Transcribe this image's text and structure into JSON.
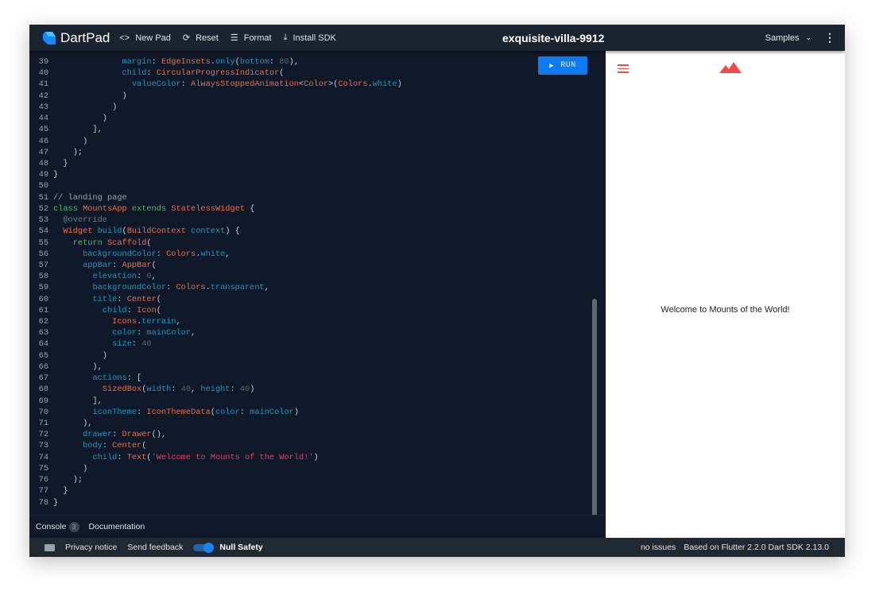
{
  "header": {
    "app_name": "DartPad",
    "new_pad": "New Pad",
    "reset": "Reset",
    "format": "Format",
    "install_sdk": "Install SDK",
    "title": "exquisite-villa-9912",
    "samples": "Samples"
  },
  "editor": {
    "run_label": "RUN",
    "lines": [
      {
        "n": "39",
        "t": [
          [
            "o",
            "              "
          ],
          [
            "p",
            "margin"
          ],
          [
            "o",
            ": "
          ],
          [
            "t",
            "EdgeInsets"
          ],
          [
            "o",
            "."
          ],
          [
            "p",
            "only"
          ],
          [
            "o",
            "("
          ],
          [
            "p",
            "bottom"
          ],
          [
            "o",
            ": "
          ],
          [
            "n",
            "80"
          ],
          [
            "o",
            "),"
          ]
        ]
      },
      {
        "n": "40",
        "t": [
          [
            "o",
            "              "
          ],
          [
            "p",
            "child"
          ],
          [
            "o",
            ": "
          ],
          [
            "t",
            "CircularProgressIndicator"
          ],
          [
            "o",
            "("
          ]
        ]
      },
      {
        "n": "41",
        "t": [
          [
            "o",
            "                "
          ],
          [
            "p",
            "valueColor"
          ],
          [
            "o",
            ": "
          ],
          [
            "t",
            "AlwaysStoppedAnimation"
          ],
          [
            "o",
            "<"
          ],
          [
            "t",
            "Color"
          ],
          [
            "o",
            ">("
          ],
          [
            "t",
            "Colors"
          ],
          [
            "o",
            "."
          ],
          [
            "p",
            "white"
          ],
          [
            "o",
            ")"
          ]
        ]
      },
      {
        "n": "42",
        "t": [
          [
            "o",
            "              )"
          ]
        ]
      },
      {
        "n": "43",
        "t": [
          [
            "o",
            "            )"
          ]
        ]
      },
      {
        "n": "44",
        "t": [
          [
            "o",
            "          )"
          ]
        ]
      },
      {
        "n": "45",
        "t": [
          [
            "o",
            "        ],"
          ]
        ]
      },
      {
        "n": "46",
        "t": [
          [
            "o",
            "      )"
          ]
        ]
      },
      {
        "n": "47",
        "t": [
          [
            "o",
            "    );"
          ]
        ]
      },
      {
        "n": "48",
        "t": [
          [
            "o",
            "  }"
          ]
        ]
      },
      {
        "n": "49",
        "t": [
          [
            "o",
            "}"
          ]
        ]
      },
      {
        "n": "50",
        "t": []
      },
      {
        "n": "51",
        "t": [
          [
            "c",
            "// landing page"
          ]
        ]
      },
      {
        "n": "52",
        "t": [
          [
            "k",
            "class "
          ],
          [
            "t",
            "MountsApp"
          ],
          [
            "k",
            " extends "
          ],
          [
            "t",
            "StatelessWidget"
          ],
          [
            "o",
            " {"
          ]
        ]
      },
      {
        "n": "53",
        "t": [
          [
            "o",
            "  "
          ],
          [
            "a",
            "@override"
          ]
        ]
      },
      {
        "n": "54",
        "t": [
          [
            "o",
            "  "
          ],
          [
            "t",
            "Widget"
          ],
          [
            "o",
            " "
          ],
          [
            "p",
            "build"
          ],
          [
            "o",
            "("
          ],
          [
            "t",
            "BuildContext"
          ],
          [
            "o",
            " "
          ],
          [
            "p",
            "context"
          ],
          [
            "o",
            ") {"
          ]
        ]
      },
      {
        "n": "55",
        "t": [
          [
            "o",
            "    "
          ],
          [
            "k",
            "return "
          ],
          [
            "t",
            "Scaffold"
          ],
          [
            "o",
            "("
          ]
        ]
      },
      {
        "n": "56",
        "t": [
          [
            "o",
            "      "
          ],
          [
            "p",
            "backgroundColor"
          ],
          [
            "o",
            ": "
          ],
          [
            "t",
            "Colors"
          ],
          [
            "o",
            "."
          ],
          [
            "p",
            "white"
          ],
          [
            "o",
            ","
          ]
        ]
      },
      {
        "n": "57",
        "t": [
          [
            "o",
            "      "
          ],
          [
            "p",
            "appBar"
          ],
          [
            "o",
            ": "
          ],
          [
            "t",
            "AppBar"
          ],
          [
            "o",
            "("
          ]
        ]
      },
      {
        "n": "58",
        "t": [
          [
            "o",
            "        "
          ],
          [
            "p",
            "elevation"
          ],
          [
            "o",
            ": "
          ],
          [
            "n",
            "0"
          ],
          [
            "o",
            ","
          ]
        ]
      },
      {
        "n": "59",
        "t": [
          [
            "o",
            "        "
          ],
          [
            "p",
            "backgroundColor"
          ],
          [
            "o",
            ": "
          ],
          [
            "t",
            "Colors"
          ],
          [
            "o",
            "."
          ],
          [
            "p",
            "transparent"
          ],
          [
            "o",
            ","
          ]
        ]
      },
      {
        "n": "60",
        "t": [
          [
            "o",
            "        "
          ],
          [
            "p",
            "title"
          ],
          [
            "o",
            ": "
          ],
          [
            "t",
            "Center"
          ],
          [
            "o",
            "("
          ]
        ]
      },
      {
        "n": "61",
        "t": [
          [
            "o",
            "          "
          ],
          [
            "p",
            "child"
          ],
          [
            "o",
            ": "
          ],
          [
            "t",
            "Icon"
          ],
          [
            "o",
            "("
          ]
        ]
      },
      {
        "n": "62",
        "t": [
          [
            "o",
            "            "
          ],
          [
            "t",
            "Icons"
          ],
          [
            "o",
            "."
          ],
          [
            "p",
            "terrain"
          ],
          [
            "o",
            ","
          ]
        ]
      },
      {
        "n": "63",
        "t": [
          [
            "o",
            "            "
          ],
          [
            "p",
            "color"
          ],
          [
            "o",
            ": "
          ],
          [
            "p",
            "mainColor"
          ],
          [
            "o",
            ","
          ]
        ]
      },
      {
        "n": "64",
        "t": [
          [
            "o",
            "            "
          ],
          [
            "p",
            "size"
          ],
          [
            "o",
            ": "
          ],
          [
            "n",
            "40"
          ]
        ]
      },
      {
        "n": "65",
        "t": [
          [
            "o",
            "          )"
          ]
        ]
      },
      {
        "n": "66",
        "t": [
          [
            "o",
            "        ),"
          ]
        ]
      },
      {
        "n": "67",
        "t": [
          [
            "o",
            "        "
          ],
          [
            "p",
            "actions"
          ],
          [
            "o",
            ": ["
          ]
        ]
      },
      {
        "n": "68",
        "t": [
          [
            "o",
            "          "
          ],
          [
            "t",
            "SizedBox"
          ],
          [
            "o",
            "("
          ],
          [
            "p",
            "width"
          ],
          [
            "o",
            ": "
          ],
          [
            "n",
            "40"
          ],
          [
            "o",
            ", "
          ],
          [
            "p",
            "height"
          ],
          [
            "o",
            ": "
          ],
          [
            "n",
            "40"
          ],
          [
            "o",
            ")"
          ]
        ]
      },
      {
        "n": "69",
        "t": [
          [
            "o",
            "        ],"
          ]
        ]
      },
      {
        "n": "70",
        "t": [
          [
            "o",
            "        "
          ],
          [
            "p",
            "iconTheme"
          ],
          [
            "o",
            ": "
          ],
          [
            "t",
            "IconThemeData"
          ],
          [
            "o",
            "("
          ],
          [
            "p",
            "color"
          ],
          [
            "o",
            ": "
          ],
          [
            "p",
            "mainColor"
          ],
          [
            "o",
            ")"
          ]
        ]
      },
      {
        "n": "71",
        "t": [
          [
            "o",
            "      ),"
          ]
        ]
      },
      {
        "n": "72",
        "t": [
          [
            "o",
            "      "
          ],
          [
            "p",
            "drawer"
          ],
          [
            "o",
            ": "
          ],
          [
            "t",
            "Drawer"
          ],
          [
            "o",
            "(),"
          ]
        ]
      },
      {
        "n": "73",
        "t": [
          [
            "o",
            "      "
          ],
          [
            "p",
            "body"
          ],
          [
            "o",
            ": "
          ],
          [
            "t",
            "Center"
          ],
          [
            "o",
            "("
          ]
        ]
      },
      {
        "n": "74",
        "t": [
          [
            "o",
            "        "
          ],
          [
            "p",
            "child"
          ],
          [
            "o",
            ": "
          ],
          [
            "t",
            "Text"
          ],
          [
            "o",
            "("
          ],
          [
            "s",
            "'Welcome to Mounts of the World!'"
          ],
          [
            "o",
            ")"
          ]
        ]
      },
      {
        "n": "75",
        "t": [
          [
            "o",
            "      )"
          ]
        ]
      },
      {
        "n": "76",
        "t": [
          [
            "o",
            "    );"
          ]
        ]
      },
      {
        "n": "77",
        "t": [
          [
            "o",
            "  }"
          ]
        ]
      },
      {
        "n": "78",
        "t": [
          [
            "o",
            "}"
          ]
        ]
      }
    ]
  },
  "console": {
    "tab": "Console",
    "count": "3",
    "documentation": "Documentation"
  },
  "output": {
    "welcome": "Welcome to Mounts of the World!",
    "accent": "#f24a4a"
  },
  "footer": {
    "privacy": "Privacy notice",
    "feedback": "Send feedback",
    "null_safety": "Null Safety",
    "null_safety_on": true,
    "issues": "no issues",
    "version": "Based on Flutter 2.2.0 Dart SDK 2.13.0"
  }
}
